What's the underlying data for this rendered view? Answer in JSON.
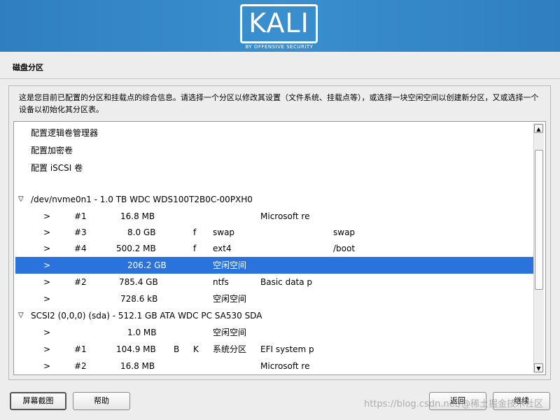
{
  "header": {
    "logo_text": "KALI",
    "logo_sub": "BY OFFENSIVE SECURITY"
  },
  "page_title": "磁盘分区",
  "description": "这是您目前已配置的分区和挂载点的综合信息。请选择一个分区以修改其设置（文件系统、挂载点等），或选择一块空闲空间以创建新分区，又或选择一个设备以初始化其分区表。",
  "list": {
    "actions": [
      "配置逻辑卷管理器",
      "配置加密卷",
      "配置 iSCSI 卷"
    ],
    "disks": [
      {
        "label": "/dev/nvme0n1 - 1.0 TB WDC WDS100T2B0C-00PXH0",
        "expand": "▽",
        "partitions": [
          {
            "arrow": ">",
            "num": "#1",
            "size": "16.8 MB",
            "flag1": "",
            "flag2": "",
            "fs": "",
            "name": "Microsoft re",
            "mount": ""
          },
          {
            "arrow": ">",
            "num": "#3",
            "size": "8.0 GB",
            "flag1": "f",
            "flag2": "",
            "fs": "swap",
            "name": "",
            "mount": "swap"
          },
          {
            "arrow": ">",
            "num": "#4",
            "size": "500.2 MB",
            "flag1": "f",
            "flag2": "",
            "fs": "ext4",
            "name": "",
            "mount": "/boot"
          },
          {
            "arrow": ">",
            "num": "",
            "size": "206.2 GB",
            "flag1": "",
            "flag2": "",
            "fs": "空闲空间",
            "name": "",
            "mount": "",
            "selected": true
          },
          {
            "arrow": ">",
            "num": "#2",
            "size": "785.4 GB",
            "flag1": "",
            "flag2": "",
            "fs": "ntfs",
            "name": "Basic data p",
            "mount": ""
          },
          {
            "arrow": ">",
            "num": "",
            "size": "728.6 kB",
            "flag1": "",
            "flag2": "",
            "fs": "空闲空间",
            "name": "",
            "mount": ""
          }
        ]
      },
      {
        "label": "SCSI2 (0,0,0) (sda) - 512.1 GB ATA WDC PC SA530 SDA",
        "expand": "▽",
        "partitions": [
          {
            "arrow": ">",
            "num": "",
            "size": "1.0 MB",
            "flag1": "",
            "flag2": "",
            "fs": "空闲空间",
            "name": "",
            "mount": ""
          },
          {
            "arrow": ">",
            "num": "#1",
            "size": "104.9 MB",
            "flag1": "B",
            "flag2": "K",
            "fs": "系统分区",
            "name": "EFI system p",
            "mount": ""
          },
          {
            "arrow": ">",
            "num": "#2",
            "size": "16.8 MB",
            "flag1": "",
            "flag2": "",
            "fs": "",
            "name": "Microsoft re",
            "mount": ""
          }
        ]
      }
    ]
  },
  "scrollbar": {
    "up": "▲",
    "down": "▼"
  },
  "buttons": {
    "screenshot": "屏幕截图",
    "help": "帮助",
    "back": "返回",
    "continue": "继续"
  },
  "watermark": "https://blog.csdn.net/@稀土掘金技术社区",
  "colors": {
    "banner": "#3a8fcf",
    "selection": "#2a73dc"
  }
}
